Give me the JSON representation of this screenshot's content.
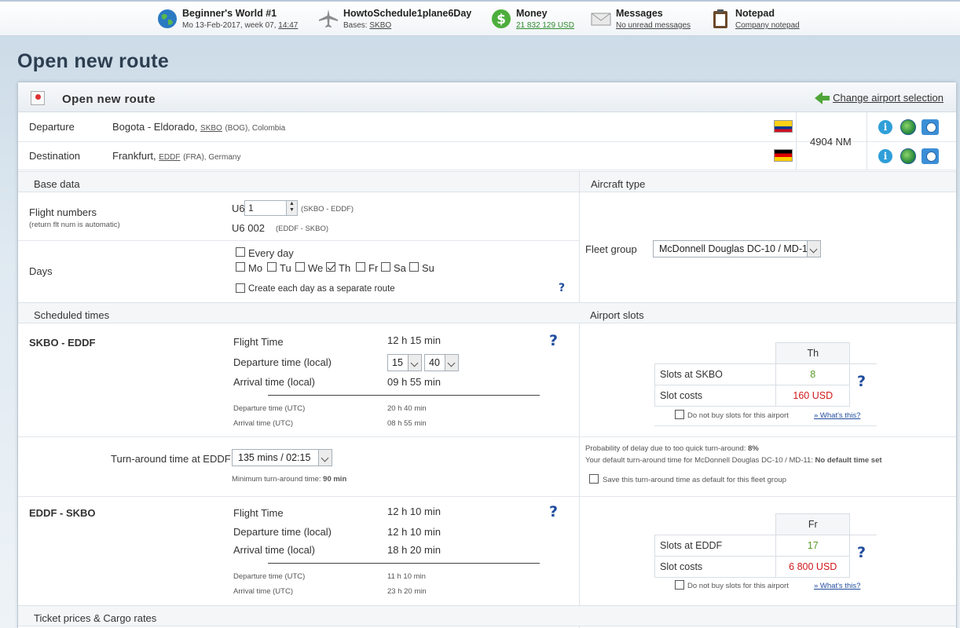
{
  "topbar": {
    "world": {
      "title": "Beginner's World #1",
      "date": "Mo 13-Feb-2017, week 07,",
      "time": "14:47"
    },
    "airline": {
      "title": "HowtoSchedule1plane6Day",
      "bases_label": "Bases:",
      "base": "SKBO"
    },
    "money": {
      "title": "Money",
      "amount": "21 832 129 USD"
    },
    "messages": {
      "title": "Messages",
      "status": "No unread messages"
    },
    "notepad": {
      "title": "Notepad",
      "link": "Company notepad"
    }
  },
  "page_title": "Open new route",
  "panel": {
    "title": "Open new route",
    "change_link": "Change airport selection",
    "departure": {
      "label": "Departure",
      "city": "Bogota - Eldorado,",
      "icao": "SKBO",
      "iata": "(BOG), Colombia"
    },
    "destination": {
      "label": "Destination",
      "city": "Frankfurt,",
      "icao": "EDDF",
      "iata": "(FRA), Germany"
    },
    "distance": "4904 NM"
  },
  "base_data": {
    "header": "Base data",
    "flight_numbers_label": "Flight numbers",
    "flight_numbers_note": "(return flt num is automatic)",
    "prefix": "U6",
    "flight_number_value": "1",
    "outbound_route": "(SKBO - EDDF)",
    "return_flight": "U6 002",
    "return_route": "(EDDF - SKBO)",
    "days_label": "Days",
    "every_day": "Every day",
    "days": [
      "Mo",
      "Tu",
      "We",
      "Th",
      "Fr",
      "Sa",
      "Su"
    ],
    "separate_route": "Create each day as a separate route",
    "help": "?"
  },
  "aircraft_type": {
    "header": "Aircraft type",
    "fleet_group_label": "Fleet group",
    "fleet_group_value": "McDonnell Douglas DC-10 / MD-11"
  },
  "scheduled_times": {
    "header": "Scheduled times",
    "outbound": {
      "route": "SKBO - EDDF",
      "flight_time_label": "Flight Time",
      "flight_time": "12 h 15 min",
      "departure_label": "Departure time (local)",
      "dep_hour": "15",
      "dep_min": "40",
      "arrival_label": "Arrival time (local)",
      "arrival": "09 h 55 min",
      "dep_utc_label": "Departure time (UTC)",
      "dep_utc": "20 h 40 min",
      "arr_utc_label": "Arrival time (UTC)",
      "arr_utc": "08 h 55 min"
    },
    "turnaround": {
      "label": "Turn-around time at EDDF",
      "value": "135 mins / 02:15",
      "min_label": "Minimum turn-around time:",
      "min_value": "90 min"
    },
    "return": {
      "route": "EDDF - SKBO",
      "flight_time_label": "Flight Time",
      "flight_time": "12 h 10 min",
      "departure_label": "Departure time (local)",
      "departure": "12 h 10 min",
      "arrival_label": "Arrival time (local)",
      "arrival": "18 h 20 min",
      "dep_utc_label": "Departure time (UTC)",
      "dep_utc": "11 h 10 min",
      "arr_utc_label": "Arrival time (UTC)",
      "arr_utc": "23 h 20 min"
    }
  },
  "airport_slots": {
    "header": "Airport slots",
    "outbound": {
      "day": "Th",
      "slots_label": "Slots at SKBO",
      "slots": "8",
      "cost_label": "Slot costs",
      "cost": "160 USD"
    },
    "return": {
      "day": "Fr",
      "slots_label": "Slots at EDDF",
      "slots": "17",
      "cost_label": "Slot costs",
      "cost": "6 800 USD"
    },
    "no_buy": "Do not buy slots for this airport",
    "whats_this": "» What's this?"
  },
  "delay_info": {
    "prob_label": "Probability of delay due to too quick turn-around:",
    "prob_value": "8%",
    "default_label": "Your default turn-around time for McDonnell Douglas DC-10 / MD-11:",
    "default_value": "No default time set",
    "save_default": "Save this turn-around time as default for this fleet group"
  },
  "ticket_header": "Ticket prices & Cargo rates"
}
